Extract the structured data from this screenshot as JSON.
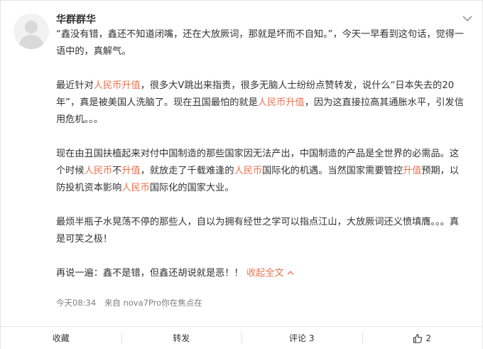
{
  "post": {
    "username": "华群群华",
    "paragraphs": [
      [
        {
          "t": "“鑫没有错，鑫还不知道闭嘴，还在大放厥词，那就是坏而不自知。”，今天一早看到这句话，觉得一语中的，真解气。",
          "h": false
        }
      ],
      [
        {
          "t": "最近针对",
          "h": false
        },
        {
          "t": "人民币升值",
          "h": true
        },
        {
          "t": "，很多大V跳出来指责，很多无脑人士纷纷点赞转发，说什么“日本失去的20年”，真是被美国人洗脑了。现在丑国最怕的就是",
          "h": false
        },
        {
          "t": "人民币升值",
          "h": true
        },
        {
          "t": "，因为这直接拉高其通胀水平，引发信用危机。。。",
          "h": false
        }
      ],
      [
        {
          "t": "现在由丑国扶植起来对付中国制造的那些国家因无法产出，中国制造的产品是全世界的必需品。这个时候",
          "h": false
        },
        {
          "t": "人民币",
          "h": true
        },
        {
          "t": "不",
          "h": false
        },
        {
          "t": "升值",
          "h": true
        },
        {
          "t": "，就放走了千载难逢的",
          "h": false
        },
        {
          "t": "人民币",
          "h": true
        },
        {
          "t": "国际化的机遇。当然国家需要管控",
          "h": false
        },
        {
          "t": "升值",
          "h": true
        },
        {
          "t": "预期，以防投机资本影响",
          "h": false
        },
        {
          "t": "人民币",
          "h": true
        },
        {
          "t": "国际化的国家大业。",
          "h": false
        }
      ],
      [
        {
          "t": "最烦半瓶子水晃荡不停的那些人，自以为拥有经世之学可以指点江山，大放厥词还义愤填膺。。。真是可笑之极！",
          "h": false
        }
      ]
    ],
    "last_line": "再说一遍：鑫不是错，但鑫还胡说就是恶！！",
    "collapse_label": "收起全文",
    "timestamp": "今天08:34",
    "source": "来自 nova7Pro你在焦点在"
  },
  "actions": {
    "favorite_label": "收藏",
    "repost_label": "转发",
    "comment_label": "评论 3",
    "like_count": "2"
  },
  "colors": {
    "highlight": "#eb7350",
    "meta": "#808080"
  },
  "icons": [
    "avatar-placeholder",
    "chevron-down-icon",
    "collapse-up-icon",
    "thumbs-up-icon"
  ]
}
